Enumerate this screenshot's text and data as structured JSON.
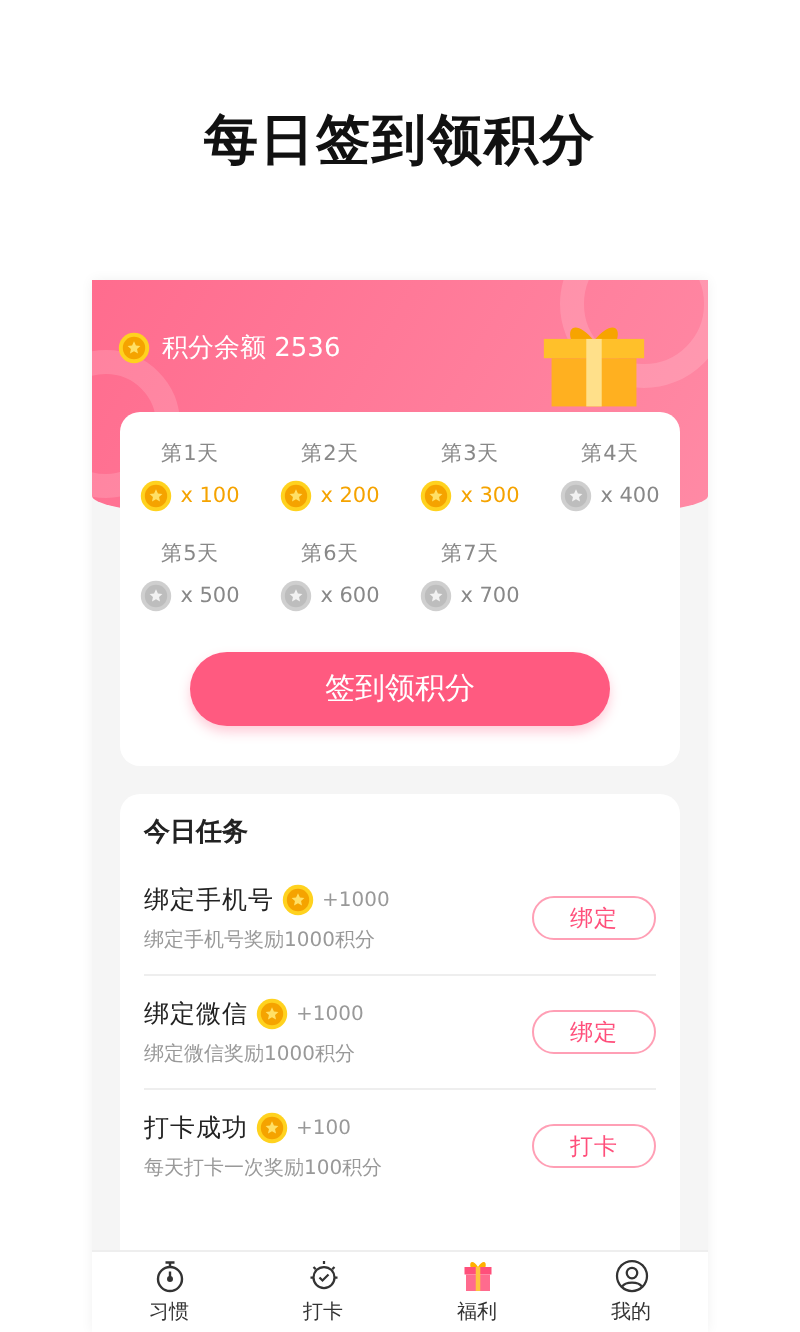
{
  "page_title": "每日签到领积分",
  "balance": {
    "label": "积分余额 2536"
  },
  "days": [
    {
      "label": "第1天",
      "amount": "x 100",
      "claimed": true
    },
    {
      "label": "第2天",
      "amount": "x 200",
      "claimed": true
    },
    {
      "label": "第3天",
      "amount": "x 300",
      "claimed": true
    },
    {
      "label": "第4天",
      "amount": "x 400",
      "claimed": false
    },
    {
      "label": "第5天",
      "amount": "x 500",
      "claimed": false
    },
    {
      "label": "第6天",
      "amount": "x 600",
      "claimed": false
    },
    {
      "label": "第7天",
      "amount": "x 700",
      "claimed": false
    }
  ],
  "sign_button": "签到领积分",
  "tasks_title": "今日任务",
  "tasks": [
    {
      "title": "绑定手机号",
      "points": "+1000",
      "desc": "绑定手机号奖励1000积分",
      "action": "绑定"
    },
    {
      "title": "绑定微信",
      "points": "+1000",
      "desc": "绑定微信奖励1000积分",
      "action": "绑定"
    },
    {
      "title": "打卡成功",
      "points": "+100",
      "desc": "每天打卡一次奖励100积分",
      "action": "打卡"
    }
  ],
  "tabs": [
    {
      "kind": "stopwatch",
      "label": "习惯",
      "selected": false
    },
    {
      "kind": "checkin",
      "label": "打卡",
      "selected": false
    },
    {
      "kind": "gift",
      "label": "福利",
      "selected": true
    },
    {
      "kind": "profile",
      "label": "我的",
      "selected": false
    }
  ]
}
